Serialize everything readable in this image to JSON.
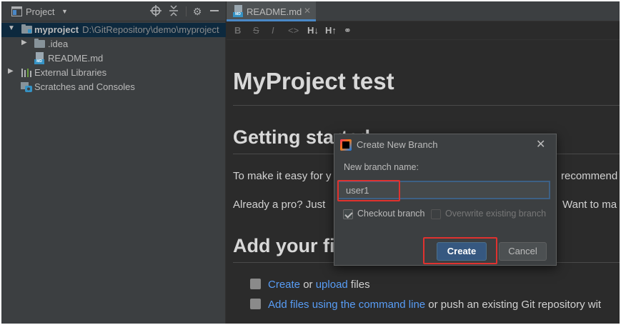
{
  "project_panel": {
    "title": "Project",
    "tree": [
      {
        "label": "myproject",
        "path": "D:\\GitRepository\\demo\\myproject"
      },
      {
        "label": ".idea"
      },
      {
        "label": "README.md"
      },
      {
        "label": "External Libraries"
      },
      {
        "label": "Scratches and Consoles"
      }
    ]
  },
  "editor": {
    "tab_label": "README.md",
    "toolbar": [
      "B",
      "S",
      "I",
      "<>",
      "H↓",
      "H↑",
      "⚭"
    ],
    "preview": {
      "h1": "MyProject test",
      "h2_started": "Getting started",
      "para1_start": "To make it easy for y",
      "para1_end": "recommend",
      "para2_start": "Already a pro? Just",
      "para2_end": "Want to ma",
      "h2_files": "Add your files",
      "item1": {
        "link1": "Create",
        "text1": " or ",
        "link2": "upload",
        "text2": " files"
      },
      "item2": {
        "link1": "Add files using the command line",
        "text1": " or push an existing Git repository wit"
      }
    }
  },
  "dialog": {
    "title": "Create New Branch",
    "label": "New branch name:",
    "input_value": "user1",
    "checkout_label": "Checkout branch",
    "overwrite_label": "Overwrite existing branch",
    "create_label": "Create",
    "cancel_label": "Cancel"
  },
  "colors": {
    "accent": "#365880",
    "link": "#589df6",
    "annotation": "#e0322f"
  }
}
